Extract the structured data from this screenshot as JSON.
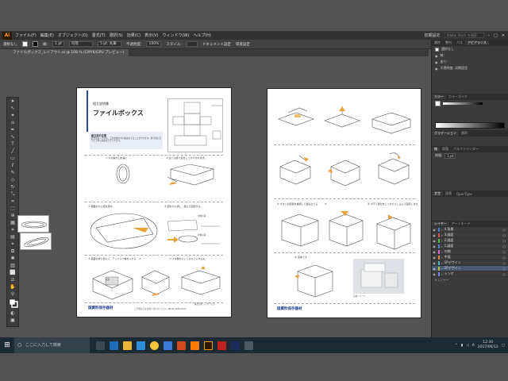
{
  "app": {
    "logo": "Ai",
    "menu": [
      "ファイル(F)",
      "編集(E)",
      "オブジェクト(O)",
      "書式(T)",
      "選択(S)",
      "効果(C)",
      "表示(V)",
      "ウィンドウ(W)",
      "ヘルプ(H)"
    ],
    "workspace": "初期設定",
    "search_placeholder": "Adobe Stock を検索"
  },
  "controlbar": {
    "selection": "選択なし",
    "stroke_label": "線:",
    "stroke_weight": "1 pt",
    "stroke_style": "均等",
    "brush": "5 pt. 丸筆",
    "opacity_label": "不透明度:",
    "opacity": "100%",
    "style_label": "スタイル:",
    "doc_setup": "ドキュメント設定",
    "prefs": "環境設定"
  },
  "document_tab": "ファイルボックス_レイアウト.ai @ 108 % (CMYK/GPU プレビュー)",
  "page1": {
    "header_label": "組立説明書",
    "title": "ファイルボックス",
    "intro_title": "組立前の注意",
    "intro_text": "此方のボックスは、工具を使わずに組み立てることができます。折り目に沿って丁寧に組み立ててください。",
    "step1": "① 穴の開き口を開く",
    "step2": "② 全ての折り目をしっかり付けます。",
    "step3": "③ 側面の穴に紐を通す。",
    "step4": "④ 紐を穴に通し、結んで固定する。",
    "step5": "⑤ 底面の折り目にて、アップリケ等を入れる",
    "step6": "⑥",
    "step7": "⑦ フタ部分にしっかりと入れ込む",
    "label_a": "内側の面",
    "label_b": "内側の面",
    "label_c": "底面",
    "brand": "国資料保存器材",
    "footer": "ご不明な点はお問い合わせください TEL03-3978-XXXX",
    "page_info": "株式会社 ○○サービス"
  },
  "page2": {
    "step8": "⑧ ボタンの配置を確認して組み立てる",
    "step9": "⑨",
    "step10": "⑩ フタ部分にしっかりとさし込みます",
    "step11": "⑪ ボディ部分をしっかりさし込んで固定します",
    "step12": "⑫ 完成です",
    "photo_caption": "完成イメージ",
    "brand": "国資料保存器材"
  },
  "rightpanel": {
    "top_tabs": [
      "属性",
      "整列",
      "パス",
      "アピアランス"
    ],
    "appearance_rows": [
      "選択なし",
      "線:",
      "塗り:",
      "不透明度: 初期設定"
    ],
    "color_tabs": [
      "カラー",
      "カラーガイド"
    ],
    "gradient_tabs": [
      "グラデーション",
      "透明"
    ],
    "stroke_tabs": [
      "線",
      "段落",
      "パスファインダー"
    ],
    "stroke_weight_label": "線幅:",
    "stroke_weight": "1 pt",
    "char_tabs": [
      "文字",
      "段落",
      "OpenType"
    ],
    "layer_tabs": [
      "レイヤー",
      "アートボード"
    ],
    "layers": [
      {
        "name": "4.背景",
        "color": "#4a7fd4",
        "selected": false
      },
      {
        "name": "3.図面",
        "color": "#e05050",
        "selected": false
      },
      {
        "name": "2.図面",
        "color": "#4ac04a",
        "selected": false
      },
      {
        "name": "1.図面",
        "color": "#4a7fd4",
        "selected": false
      },
      {
        "name": "内側",
        "color": "#d070d0",
        "selected": false
      },
      {
        "name": "中面",
        "color": "#e08040",
        "selected": false
      },
      {
        "name": "1Pデザイン",
        "color": "#4ac0c0",
        "selected": false
      },
      {
        "name": "2Pデザイン",
        "color": "#c0c040",
        "selected": true
      },
      {
        "name": "トンボ",
        "color": "#8080ff",
        "selected": false
      }
    ],
    "layer_count": "9 レイヤー"
  },
  "taskbar": {
    "search_placeholder": "ここに入力して検索",
    "time": "12:30",
    "date": "2017/06/12",
    "ime": "A"
  }
}
